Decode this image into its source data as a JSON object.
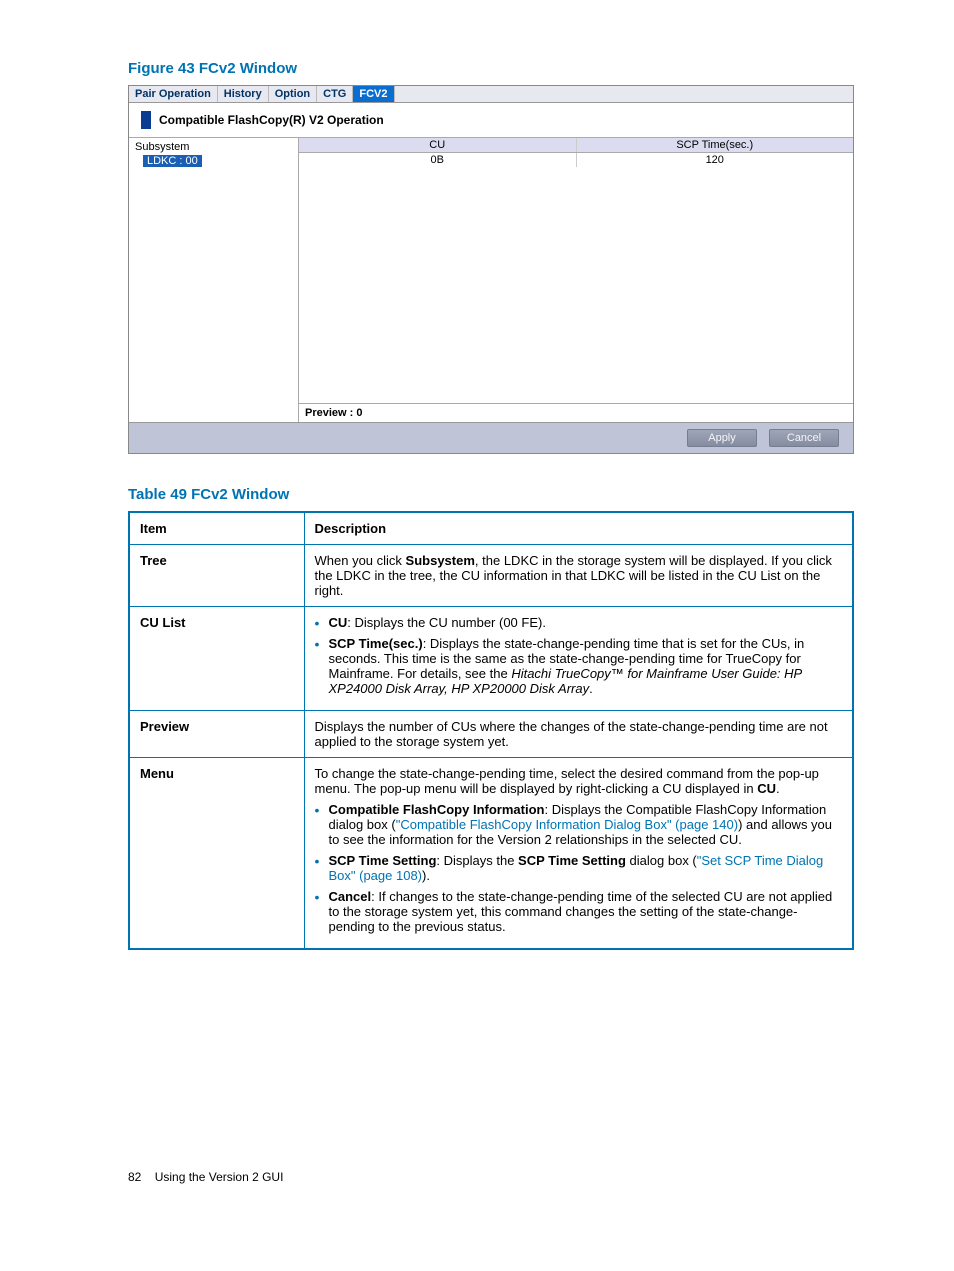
{
  "figure": {
    "title": "Figure 43 FCv2 Window"
  },
  "screenshot": {
    "tabs": [
      "Pair Operation",
      "History",
      "Option",
      "CTG",
      "FCV2"
    ],
    "active_tab": 4,
    "heading": "Compatible FlashCopy(R) V2 Operation",
    "tree": {
      "root": "Subsystem",
      "child": "LDKC : 00"
    },
    "cu_table": {
      "headers": [
        "CU",
        "SCP Time(sec.)"
      ],
      "rows": [
        [
          "0B",
          "120"
        ]
      ]
    },
    "preview_label": "Preview : 0",
    "buttons": {
      "apply": "Apply",
      "cancel": "Cancel"
    }
  },
  "table": {
    "title": "Table 49 FCv2 Window",
    "header": {
      "item": "Item",
      "desc": "Description"
    },
    "rows": {
      "tree": {
        "key": "Tree",
        "text_before": "When you click ",
        "bold1": "Subsystem",
        "text_after": ", the LDKC in the storage system will be displayed. If you click the LDKC in the tree, the CU information in that LDKC will be listed in the CU List on the right."
      },
      "cu_list": {
        "key": "CU List",
        "li1_bold": "CU",
        "li1_rest": ": Displays the CU number (00 FE).",
        "li2_bold": "SCP Time(sec.)",
        "li2_rest": ": Displays the state-change-pending time that is set for the CUs, in seconds. This time is the same as the state-change-pending time for TrueCopy for Mainframe. For details, see the ",
        "li2_italic": "Hitachi TrueCopy™ for Mainframe User Guide: HP XP24000 Disk Array, HP XP20000 Disk Array",
        "li2_end": "."
      },
      "preview": {
        "key": "Preview",
        "text": "Displays the number of CUs where the changes of the state-change-pending time are not applied to the storage system yet."
      },
      "menu": {
        "key": "Menu",
        "intro_a": "To change the state-change-pending time, select the desired command from the pop-up menu. The pop-up menu will be displayed by right-clicking a CU displayed in ",
        "intro_bold": "CU",
        "intro_b": ".",
        "li1_bold": "Compatible FlashCopy Information",
        "li1_mid": ": Displays the Compatible FlashCopy Information dialog box (",
        "li1_link": "\"Compatible FlashCopy Information Dialog Box\" (page 140)",
        "li1_end": ") and allows you to see the information for the Version 2 relationships in the selected CU.",
        "li2_bold": "SCP Time Setting",
        "li2_mid_a": ": Displays the ",
        "li2_bold2": "SCP Time Setting",
        "li2_mid_b": " dialog box (",
        "li2_link": "\"Set SCP Time Dialog Box\" (page 108)",
        "li2_end": ").",
        "li3_bold": "Cancel",
        "li3_rest": ": If changes to the state-change-pending time of the selected CU are not applied to the storage system yet, this command changes the setting of the state-change-pending to the previous status."
      }
    }
  },
  "footer": {
    "page": "82",
    "section": "Using the Version 2 GUI"
  }
}
